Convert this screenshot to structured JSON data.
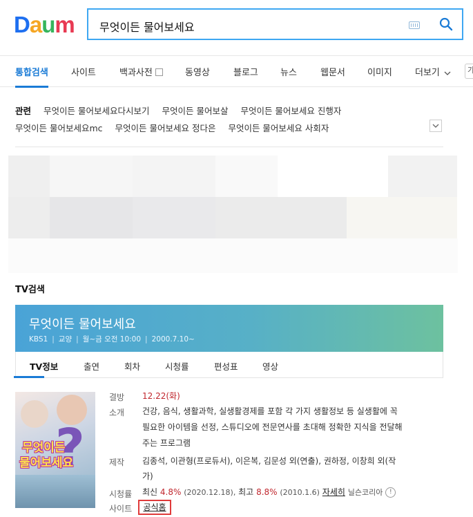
{
  "logo": {
    "letters": [
      "D",
      "a",
      "u",
      "m"
    ],
    "colors": [
      "#1e6ff0",
      "#f5a623",
      "#36b55c",
      "#e83a53"
    ]
  },
  "search": {
    "query": "무엇이든 물어보세요",
    "keyboard_icon": "keyboard-icon",
    "search_icon": "search-icon"
  },
  "tabs": [
    {
      "label": "통합검색",
      "active": true
    },
    {
      "label": "사이트"
    },
    {
      "label": "백과사전"
    },
    {
      "label": "동영상"
    },
    {
      "label": "블로그"
    },
    {
      "label": "뉴스"
    },
    {
      "label": "웹문서"
    },
    {
      "label": "이미지"
    },
    {
      "label": "더보기"
    }
  ],
  "tab_overflow": "가",
  "related": {
    "heading": "관련",
    "items": [
      "무엇이든 물어보세요다시보기",
      "무엇이든 물어보살",
      "무엇이든 물어보세요 진행자",
      "무엇이든 물어보세요mc",
      "무엇이든 물어보세요 정다은",
      "무엇이든 물어보세요 사회자"
    ]
  },
  "tv_section": {
    "title": "TV검색",
    "program_title": "무엇이든 물어보세요",
    "meta": [
      "KBS1",
      "교양",
      "월~금 오전 10:00",
      "2000.7.10~"
    ],
    "subtabs": [
      "TV정보",
      "출연",
      "회차",
      "시청률",
      "편성표",
      "영상"
    ],
    "poster_text": [
      "무엇이든",
      "물어보세요"
    ],
    "details": {
      "cancel_label": "결방",
      "cancel_value": "12.22(화)",
      "intro_label": "소개",
      "intro_lines": [
        "건강, 음식, 생활과학, 실생활경제를 포함 각 가지 생활정보 등 실생활에 꼭",
        "필요한 아이템을 선정, 스튜디오에 전문연사를 초대해 정확한 지식을 전달해",
        "주는 프로그램"
      ],
      "production_label": "제작",
      "production_lines": [
        "김종석, 이관형(프로듀서), 이은복, 김문성 외(연출), 권하정, 이창희 외(작",
        "가)"
      ],
      "rating_label": "시청률",
      "rating_latest_label": "최신",
      "rating_latest": "4.8%",
      "rating_latest_date": "(2020.12.18),",
      "rating_max_label": "최고",
      "rating_max": "8.8%",
      "rating_max_date": "(2010.1.6)",
      "rating_more": "자세히",
      "rating_source": "닐슨코리아",
      "site_label": "사이트",
      "site_value": "공식홈"
    }
  }
}
